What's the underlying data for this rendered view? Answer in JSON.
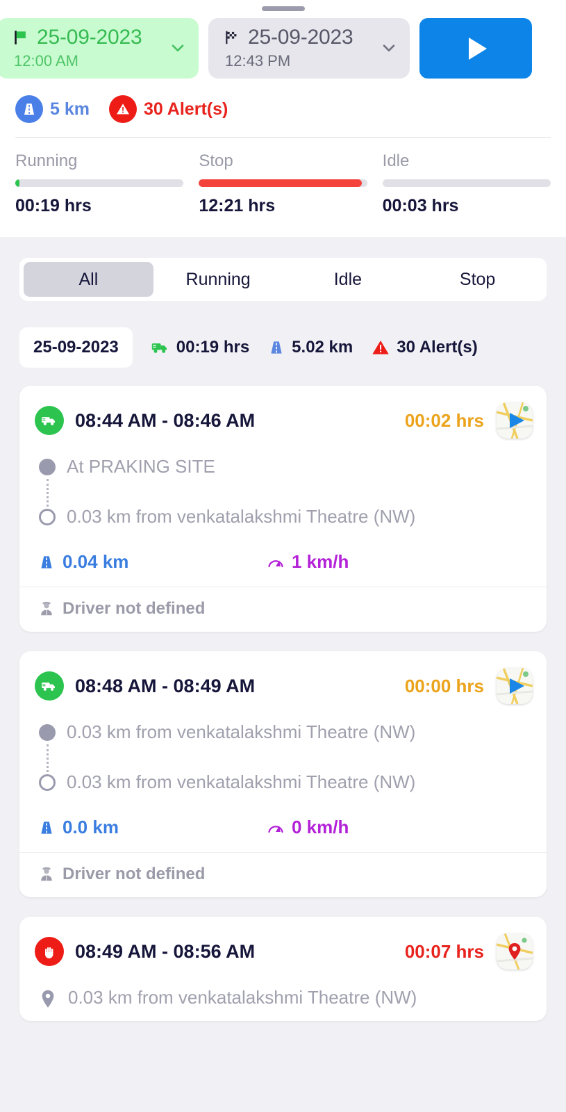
{
  "header": {
    "start_date": {
      "icon": "green-flag-icon",
      "date": "25-09-2023",
      "time": "12:00 AM"
    },
    "end_date": {
      "icon": "checkered-flag-icon",
      "date": "25-09-2023",
      "time": "12:43 PM"
    },
    "play_button": {
      "icon": "play-icon",
      "label": ""
    },
    "distance": {
      "icon": "road-icon",
      "label": "5 km"
    },
    "alerts": {
      "icon": "alert-triangle-icon",
      "label": "30 Alert(s)"
    }
  },
  "status_bars": [
    {
      "name": "Running",
      "value": "00:19 hrs",
      "percent": 2.5,
      "color": "#2cc44f"
    },
    {
      "name": "Stop",
      "value": "12:21 hrs",
      "percent": 97,
      "color": "#f4433c"
    },
    {
      "name": "Idle",
      "value": "00:03 hrs",
      "percent": 0,
      "color": "#f4433c"
    }
  ],
  "tabs": [
    {
      "label": "All",
      "active": true
    },
    {
      "label": "Running",
      "active": false
    },
    {
      "label": "Idle",
      "active": false
    },
    {
      "label": "Stop",
      "active": false
    }
  ],
  "summary": {
    "date": "25-09-2023",
    "duration": "00:19 hrs",
    "duration_icon": "truck-icon",
    "distance": "5.02 km",
    "distance_icon": "road-icon",
    "alerts": "30 Alert(s)",
    "alerts_icon": "alert-triangle-icon"
  },
  "cards": [
    {
      "type": "running",
      "status_icon": "truck-icon",
      "time_range": "08:44 AM - 08:46 AM",
      "duration": "00:02 hrs",
      "map_icon": "map-navigate-icon",
      "start_location": "At PRAKING SITE",
      "end_location": "0.03 km from venkatalakshmi Theatre (NW)",
      "distance": "0.04 km",
      "distance_icon": "road-icon",
      "speed": "1 km/h",
      "speed_icon": "speedometer-icon",
      "driver": "Driver not defined",
      "driver_icon": "driver-icon"
    },
    {
      "type": "running",
      "status_icon": "truck-icon",
      "time_range": "08:48 AM - 08:49 AM",
      "duration": "00:00 hrs",
      "map_icon": "map-navigate-icon",
      "start_location": "0.03 km from venkatalakshmi Theatre (NW)",
      "end_location": "0.03 km from venkatalakshmi Theatre (NW)",
      "distance": "0.0 km",
      "distance_icon": "road-icon",
      "speed": "0 km/h",
      "speed_icon": "speedometer-icon",
      "driver": "Driver not defined",
      "driver_icon": "driver-icon"
    },
    {
      "type": "stop",
      "status_icon": "stop-hand-icon",
      "time_range": "08:49 AM - 08:56 AM",
      "duration": "00:07 hrs",
      "map_icon": "map-pin-icon",
      "start_location": "0.03 km from venkatalakshmi Theatre (NW)",
      "end_location": "",
      "distance": "",
      "speed": "",
      "driver": ""
    }
  ],
  "colors": {
    "accent_blue": "#0d85e8",
    "green": "#2cc44f",
    "red": "#ed1c16",
    "orange": "#eba31c",
    "purple": "#b321d8",
    "page_bg": "#f1f1f5"
  }
}
